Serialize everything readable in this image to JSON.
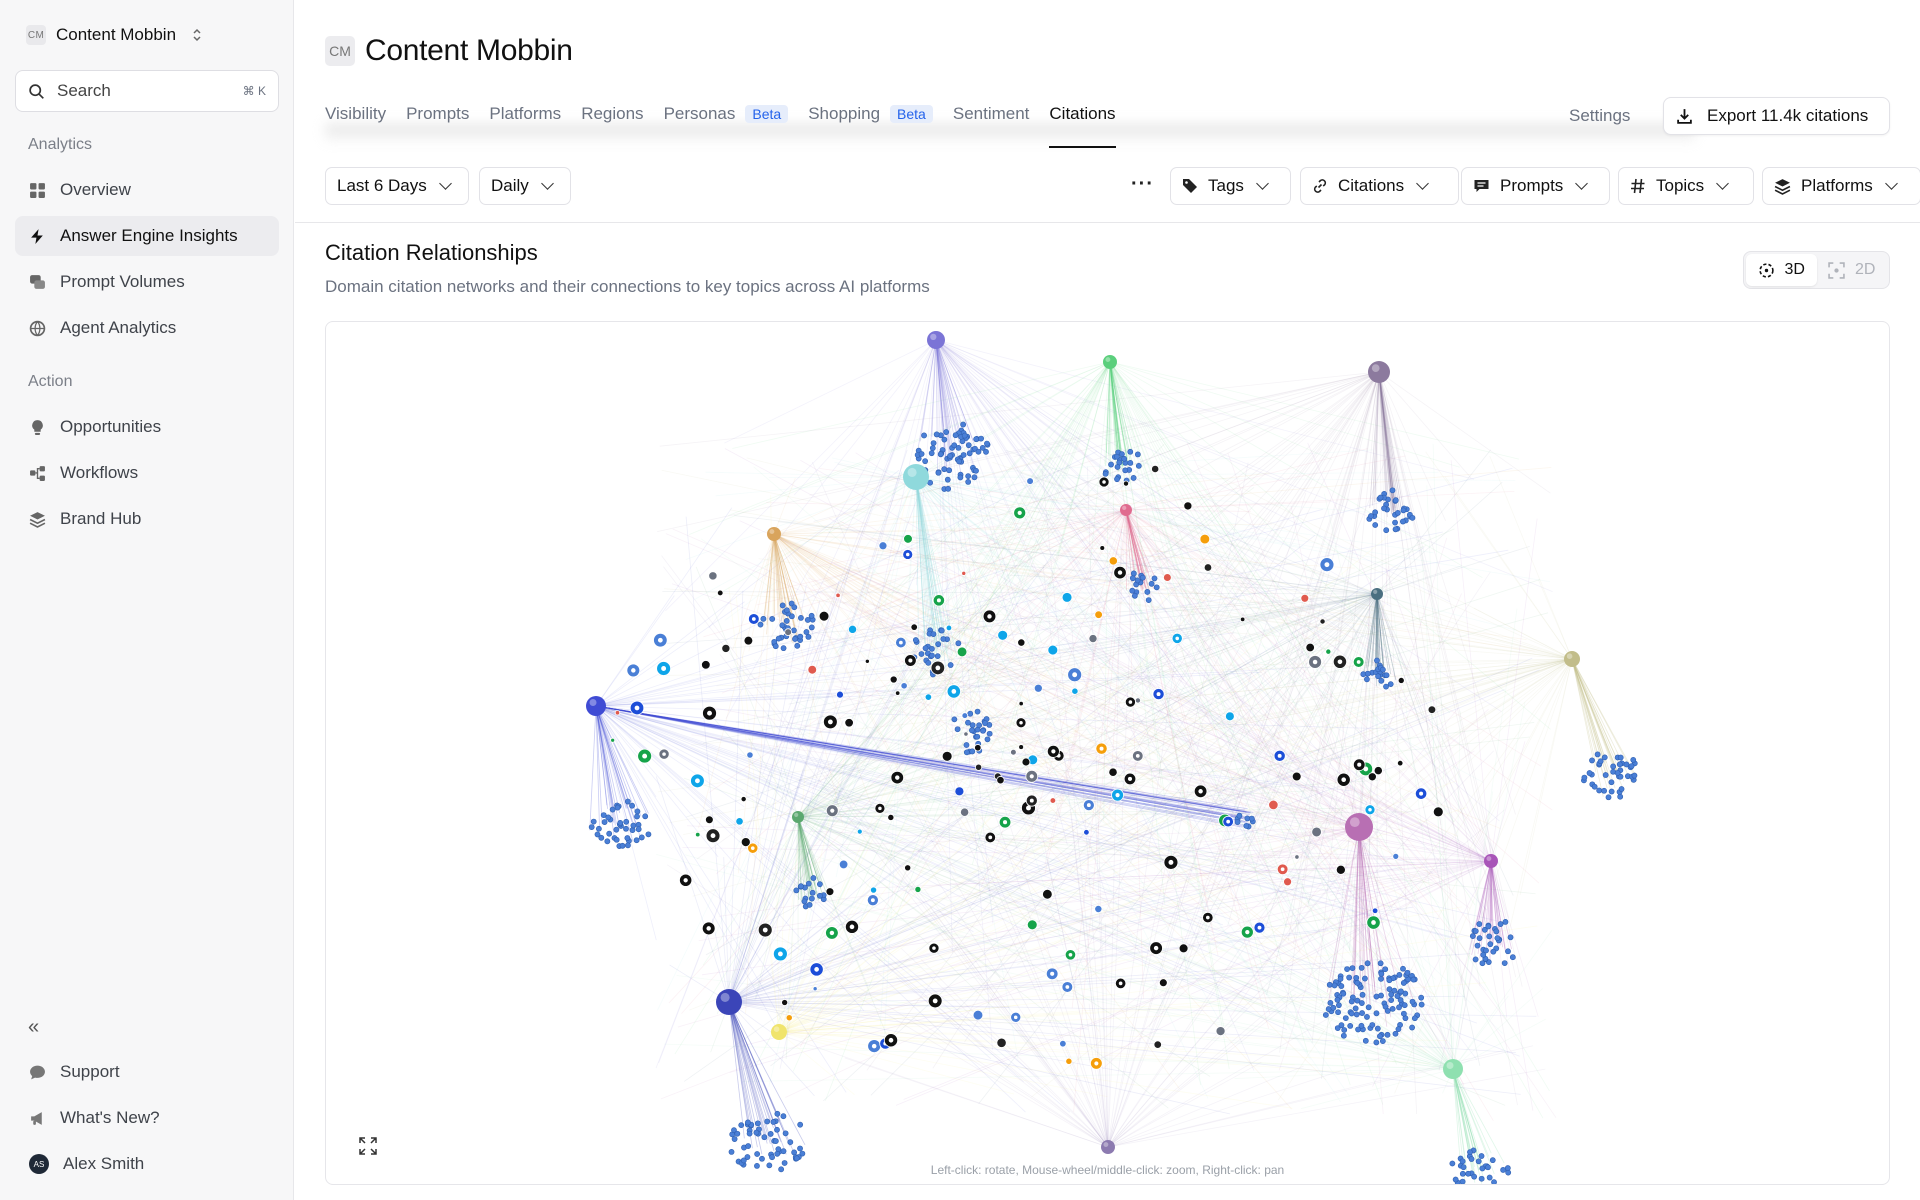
{
  "workspace": {
    "badge": "CM",
    "name": "Content Mobbin"
  },
  "search": {
    "label": "Search",
    "shortcut": "⌘ K"
  },
  "sidebar": {
    "sections": [
      {
        "label": "Analytics",
        "items": [
          {
            "label": "Overview",
            "icon": "grid-icon"
          },
          {
            "label": "Answer Engine Insights",
            "icon": "bolt-icon",
            "active": true
          },
          {
            "label": "Prompt Volumes",
            "icon": "chat-stack-icon"
          },
          {
            "label": "Agent Analytics",
            "icon": "globe-icon"
          }
        ]
      },
      {
        "label": "Action",
        "items": [
          {
            "label": "Opportunities",
            "icon": "lightbulb-icon"
          },
          {
            "label": "Workflows",
            "icon": "workflow-icon"
          },
          {
            "label": "Brand Hub",
            "icon": "layers-icon"
          }
        ]
      }
    ],
    "footer": [
      {
        "label": "Support",
        "icon": "chat-bubble-icon"
      },
      {
        "label": "What's New?",
        "icon": "megaphone-icon"
      },
      {
        "label": "Alex Smith",
        "icon": "avatar",
        "initials": "AS"
      }
    ]
  },
  "header": {
    "badge": "CM",
    "title": "Content Mobbin",
    "tabs": [
      {
        "label": "Visibility"
      },
      {
        "label": "Prompts"
      },
      {
        "label": "Platforms"
      },
      {
        "label": "Regions"
      },
      {
        "label": "Personas",
        "badge": "Beta"
      },
      {
        "label": "Shopping",
        "badge": "Beta"
      },
      {
        "label": "Sentiment"
      },
      {
        "label": "Citations",
        "active": true
      }
    ],
    "settings_label": "Settings",
    "export_label": "Export 11.4k citations"
  },
  "filters": {
    "date_range": "Last 6 Days",
    "granularity": "Daily",
    "tags": "Tags",
    "citations": "Citations",
    "prompts": "Prompts",
    "topics": "Topics",
    "platforms": "Platforms"
  },
  "card": {
    "title": "Citation Relationships",
    "subtitle": "Domain citation networks and their connections to key topics across AI platforms",
    "view_3d": "3D",
    "view_2d": "2D",
    "active_view": "3D",
    "hint": "Left-click: rotate, Mouse-wheel/middle-click: zoom, Right-click: pan"
  },
  "colors": {
    "accent": "#111111",
    "beta_text": "#2563eb",
    "beta_bg": "#e6edfb",
    "node_blue": "#4a7fd6"
  }
}
